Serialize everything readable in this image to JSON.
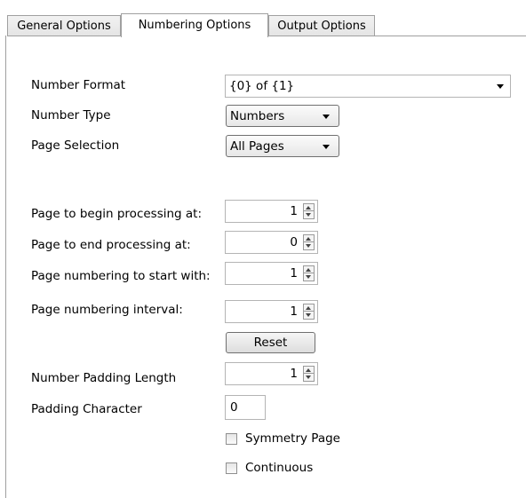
{
  "tabs": [
    {
      "label": "General Options",
      "active": false
    },
    {
      "label": "Numbering Options",
      "active": true
    },
    {
      "label": "Output Options",
      "active": false
    }
  ],
  "number_format": {
    "label": "Number Format",
    "value": "{0} of {1}"
  },
  "number_type": {
    "label": "Number Type",
    "value": "Numbers"
  },
  "page_selection": {
    "label": "Page Selection",
    "value": "All Pages"
  },
  "begin_page": {
    "label": "Page to begin processing at:",
    "value": "1"
  },
  "end_page": {
    "label": "Page to end processing at:",
    "value": "0"
  },
  "start_number": {
    "label": "Page numbering to start with:",
    "value": "1"
  },
  "interval": {
    "label": "Page numbering interval:",
    "value": "1"
  },
  "reset_button": {
    "label": "Reset"
  },
  "padding_length": {
    "label": "Number Padding Length",
    "value": "1"
  },
  "padding_char": {
    "label": "Padding Character",
    "value": "0"
  },
  "symmetry_page": {
    "label": "Symmetry Page",
    "checked": false
  },
  "continuous": {
    "label": "Continuous",
    "checked": false
  },
  "icons": {
    "dropdown": "chevron-down-icon",
    "spin_up": "arrow-up-icon",
    "spin_down": "arrow-down-icon",
    "checkbox": "checkbox-unchecked-icon"
  }
}
